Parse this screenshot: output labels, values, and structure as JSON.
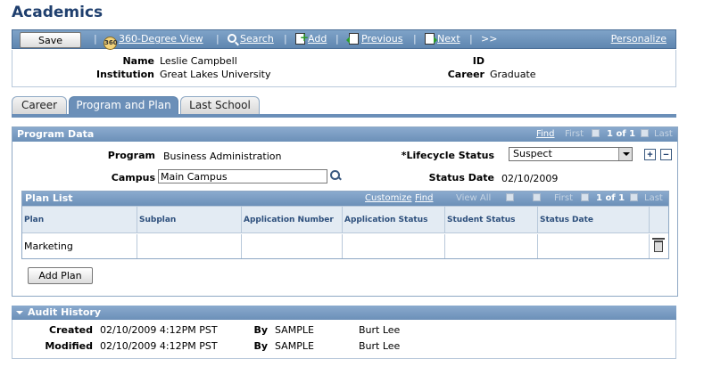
{
  "page_title": "Academics",
  "toolbar": {
    "save": "Save",
    "view360": "360-Degree View",
    "search": "Search",
    "add": "Add",
    "previous": "Previous",
    "next": "Next",
    "more": ">>",
    "personalize": "Personalize",
    "sep": "|"
  },
  "header": {
    "name_label": "Name",
    "name_value": "Leslie Campbell",
    "institution_label": "Institution",
    "institution_value": "Great Lakes University",
    "id_label": "ID",
    "id_value": "",
    "career_label": "Career",
    "career_value": "Graduate"
  },
  "tabs": [
    {
      "label": "Career",
      "active": false
    },
    {
      "label": "Program and Plan",
      "active": true
    },
    {
      "label": "Last School",
      "active": false
    }
  ],
  "program_data": {
    "title": "Program Data",
    "nav": {
      "find": "Find",
      "first": "First",
      "count": "1 of 1",
      "last": "Last"
    },
    "program_label": "Program",
    "program_value": "Business Administration",
    "lifecycle_label": "*Lifecycle Status",
    "lifecycle_value": "Suspect",
    "campus_label": "Campus",
    "campus_value": "Main Campus",
    "status_date_label": "Status Date",
    "status_date_value": "02/10/2009",
    "add_row": "+",
    "delete_row": "−"
  },
  "plan_list": {
    "title": "Plan List",
    "nav": {
      "customize": "Customize",
      "find": "Find",
      "view_all": "View All",
      "first": "First",
      "count": "1 of 1",
      "last": "Last"
    },
    "columns": [
      "Plan",
      "Subplan",
      "Application Number",
      "Application Status",
      "Student Status",
      "Status Date"
    ],
    "rows": [
      {
        "plan": "Marketing",
        "subplan": "",
        "app_number": "",
        "app_status": "",
        "student_status": "",
        "status_date": ""
      }
    ],
    "add_plan": "Add Plan"
  },
  "audit": {
    "title": "Audit History",
    "created_label": "Created",
    "created_value": "02/10/2009  4:12PM PST",
    "created_by_label": "By",
    "created_by_id": "SAMPLE",
    "created_by_name": "Burt Lee",
    "modified_label": "Modified",
    "modified_value": "02/10/2009  4:12PM PST",
    "modified_by_label": "By",
    "modified_by_id": "SAMPLE",
    "modified_by_name": "Burt Lee"
  },
  "colors": {
    "accent": "#6b8fb8",
    "title": "#1f3f6e",
    "link_dark": "#2d4f7c"
  }
}
